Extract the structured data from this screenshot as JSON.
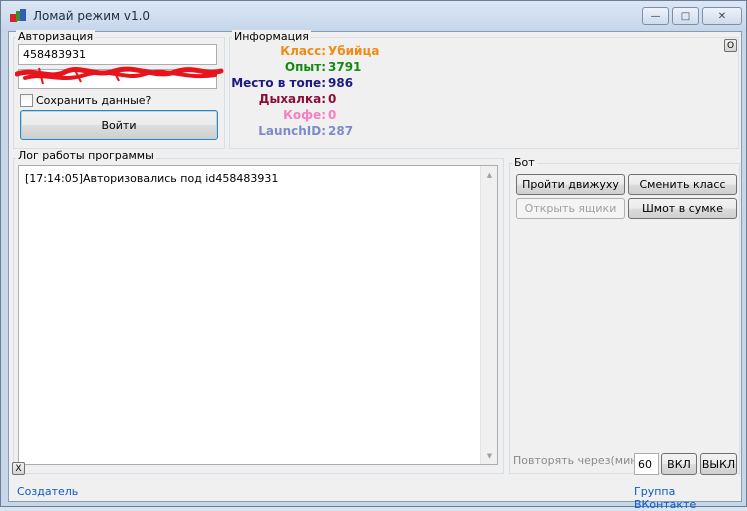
{
  "window": {
    "title": "Ломай режим v1.0",
    "controls": {
      "minimize": "—",
      "maximize": "□",
      "close": "✕"
    }
  },
  "auth": {
    "group_label": "Авторизация",
    "login_value": "458483931",
    "save_label": "Сохранить данные?",
    "login_button": "Войти"
  },
  "info": {
    "group_label": "Информация",
    "corner_button": "O",
    "rows": [
      {
        "label": "Класс:",
        "value": "Убийца",
        "color": "#f08b14"
      },
      {
        "label": "Опыт:",
        "value": "3791",
        "color": "#178a13"
      },
      {
        "label": "Место в топе:",
        "value": "986",
        "color": "#1b1a84"
      },
      {
        "label": "Дыхалка:",
        "value": "0",
        "color": "#8a0e3a"
      },
      {
        "label": "Кофе:",
        "value": "0",
        "color": "#f47fc3"
      },
      {
        "label": "LaunchID:",
        "value": "287",
        "color": "#7c8cc9"
      }
    ]
  },
  "log": {
    "group_label": "Лог работы программы",
    "lines": [
      "[17:14:05]Авторизовались под id458483931"
    ],
    "clear_button": "X"
  },
  "bot": {
    "group_label": "Бот",
    "buttons": {
      "pass_move": "Пройти движуху",
      "change_class": "Сменить класс",
      "open_boxes": "Открыть ящики",
      "bag_stuff": "Шмот в сумке"
    },
    "repeat_label": "Повторять через(мин):",
    "repeat_value": "60",
    "on_button": "ВКЛ",
    "off_button": "ВЫКЛ"
  },
  "footer": {
    "creator_link": "Создатель",
    "group_link": "Группа ВКонтакте"
  }
}
